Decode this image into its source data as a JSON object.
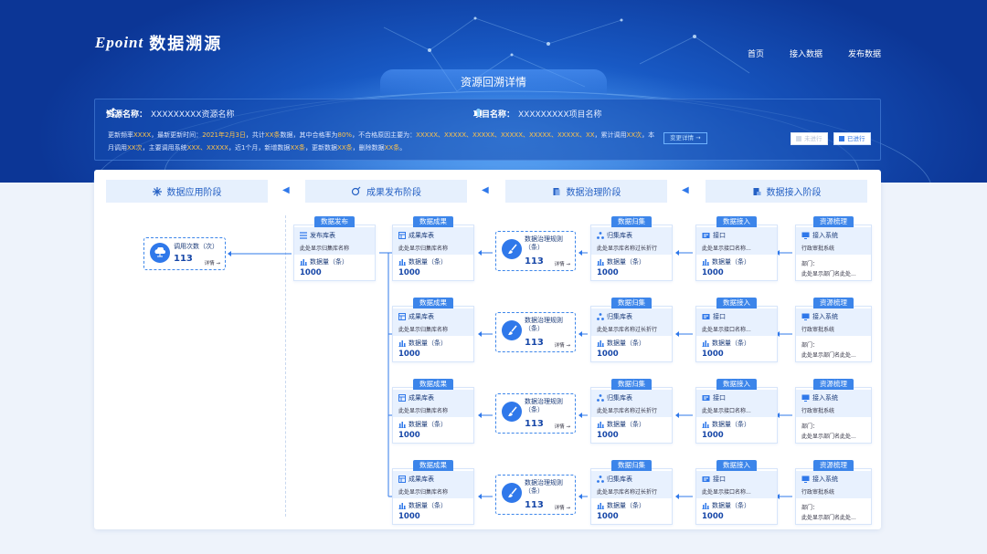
{
  "header": {
    "brand": "Epoint",
    "app_name": "数据溯源",
    "nav": [
      "首页",
      "接入数据",
      "发布数据"
    ],
    "page_title": "资源回溯详情"
  },
  "info": {
    "resource_label": "资源名称：",
    "resource_value": "XXXXXXXXX资源名称",
    "project_label": "项目名称：",
    "project_value": "XXXXXXXXX项目名称",
    "summary_parts": [
      {
        "t": "更新频率",
        "h": false
      },
      {
        "t": "XXXX",
        "h": true
      },
      {
        "t": "，最新更新时间：",
        "h": false
      },
      {
        "t": "2021年2月3日",
        "h": true
      },
      {
        "t": "，共计",
        "h": false
      },
      {
        "t": "XX条",
        "h": true
      },
      {
        "t": "数据，其中合格率为",
        "h": false
      },
      {
        "t": "80%",
        "h": true
      },
      {
        "t": "，不合格原因主要为：",
        "h": false
      },
      {
        "t": "XXXXX、XXXXX、XXXXX、XXXXX、XXXXX、XXXXX、XX",
        "h": true
      },
      {
        "t": "，累计调用",
        "h": false
      },
      {
        "t": "XX次",
        "h": true
      },
      {
        "t": "，本月调用",
        "h": false
      },
      {
        "t": "XX次",
        "h": true
      },
      {
        "t": "，主要调用系统",
        "h": false
      },
      {
        "t": "XXX、XXXXX",
        "h": true
      },
      {
        "t": "，近1个月，新增数据",
        "h": false
      },
      {
        "t": "XX条",
        "h": true
      },
      {
        "t": "，更新数据",
        "h": false
      },
      {
        "t": "XX条",
        "h": true
      },
      {
        "t": "，删除数据",
        "h": false
      },
      {
        "t": "XX条",
        "h": true
      },
      {
        "t": "。",
        "h": false
      }
    ],
    "change_detail_btn": "变更详情 →",
    "status_not": "未进行",
    "status_done": "已进行"
  },
  "stages": [
    "数据应用阶段",
    "成果发布阶段",
    "数据治理阶段",
    "数据接入阶段"
  ],
  "usage": {
    "label": "调用次数（次）",
    "value": "113",
    "detail": "详情 →"
  },
  "publish": {
    "tag": "数据发布",
    "title": "发布库表",
    "desc": "此处显示归集库名称",
    "count_label": "数据量（条）",
    "count": "1000"
  },
  "rows": [
    {
      "result": {
        "tag": "数据成果",
        "title": "成果库表",
        "desc": "此处显示归集库名称",
        "count_label": "数据量（条）",
        "count": "1000"
      },
      "rule": {
        "label": "数据治理规则（条）",
        "value": "113",
        "detail": "详情 →"
      },
      "collect": {
        "tag": "数据归集",
        "title": "归集库表",
        "desc": "此处显示库名称过长折行",
        "count_label": "数据量（条）",
        "count": "1000"
      },
      "access": {
        "tag": "数据接入",
        "title": "接口",
        "desc": "此处显示接口名称...",
        "count_label": "数据量（条）",
        "count": "1000"
      },
      "source": {
        "tag": "资源梳理",
        "title": "接入系统",
        "desc": "行政审批系统",
        "dept_label": "部门：",
        "dept": "此处显示部门名此处..."
      }
    },
    {
      "result": {
        "tag": "数据成果",
        "title": "成果库表",
        "desc": "此处显示归集库名称",
        "count_label": "数据量（条）",
        "count": "1000"
      },
      "rule": {
        "label": "数据治理规则（条）",
        "value": "113",
        "detail": "详情 →"
      },
      "collect": {
        "tag": "数据归集",
        "title": "归集库表",
        "desc": "此处显示库名称过长折行",
        "count_label": "数据量（条）",
        "count": "1000"
      },
      "access": {
        "tag": "数据接入",
        "title": "接口",
        "desc": "此处显示接口名称...",
        "count_label": "数据量（条）",
        "count": "1000"
      },
      "source": {
        "tag": "资源梳理",
        "title": "接入系统",
        "desc": "行政审批系统",
        "dept_label": "部门：",
        "dept": "此处显示部门名此处..."
      }
    },
    {
      "result": {
        "tag": "数据成果",
        "title": "成果库表",
        "desc": "此处显示归集库名称",
        "count_label": "数据量（条）",
        "count": "1000"
      },
      "rule": {
        "label": "数据治理规则（条）",
        "value": "113",
        "detail": "详情 →"
      },
      "collect": {
        "tag": "数据归集",
        "title": "归集库表",
        "desc": "此处显示库名称过长折行",
        "count_label": "数据量（条）",
        "count": "1000"
      },
      "access": {
        "tag": "数据接入",
        "title": "接口",
        "desc": "此处显示接口名称...",
        "count_label": "数据量（条）",
        "count": "1000"
      },
      "source": {
        "tag": "资源梳理",
        "title": "接入系统",
        "desc": "行政审批系统",
        "dept_label": "部门：",
        "dept": "此处显示部门名此处..."
      }
    },
    {
      "result": {
        "tag": "数据成果",
        "title": "成果库表",
        "desc": "此处显示归集库名称",
        "count_label": "数据量（条）",
        "count": "1000"
      },
      "rule": {
        "label": "数据治理规则（条）",
        "value": "113",
        "detail": "详情 →"
      },
      "collect": {
        "tag": "数据归集",
        "title": "归集库表",
        "desc": "此处显示库名称过长折行",
        "count_label": "数据量（条）",
        "count": "1000"
      },
      "access": {
        "tag": "数据接入",
        "title": "接口",
        "desc": "此处显示接口名称...",
        "count_label": "数据量（条）",
        "count": "1000"
      },
      "source": {
        "tag": "资源梳理",
        "title": "接入系统",
        "desc": "行政审批系统",
        "dept_label": "部门：",
        "dept": "此处显示部门名此处..."
      }
    }
  ],
  "colors": {
    "primary": "#2f78ea",
    "highlight": "#ffc34a",
    "hero_dark": "#0c3696"
  }
}
